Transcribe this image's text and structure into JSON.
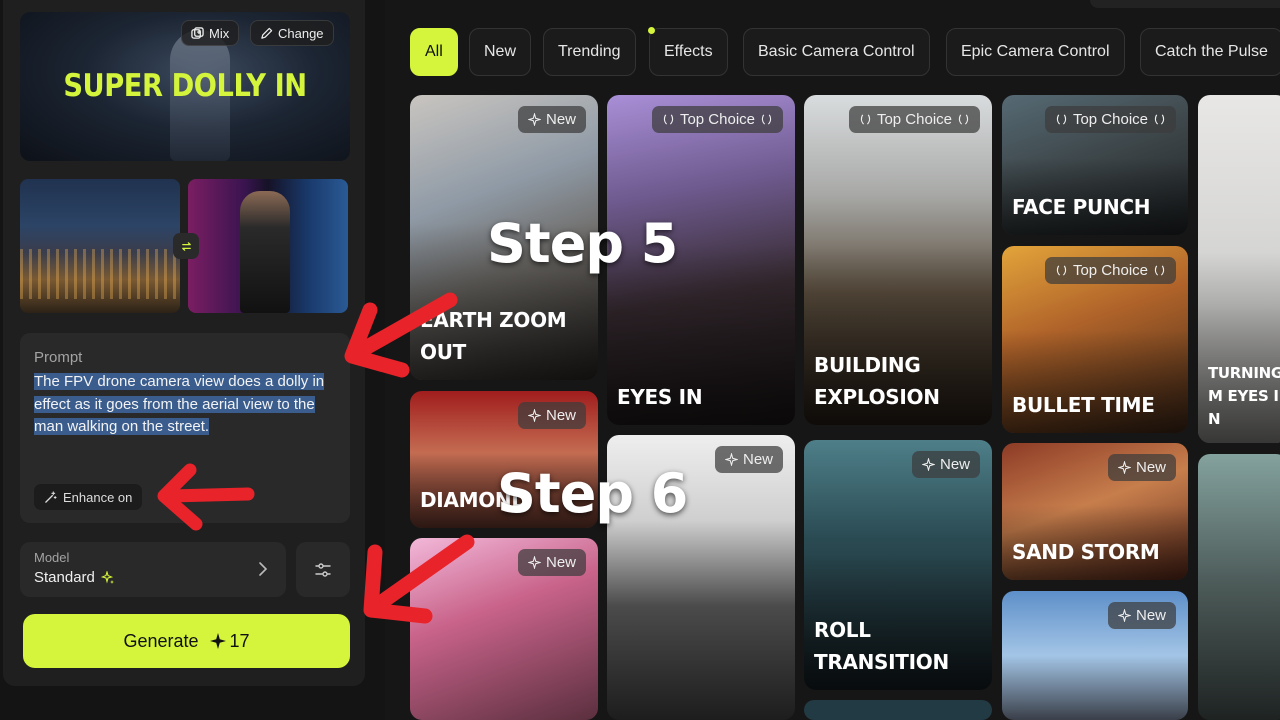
{
  "preset": {
    "title": "SUPER DOLLY IN",
    "mix_label": "Mix",
    "change_label": "Change"
  },
  "prompt": {
    "label": "Prompt",
    "text": "The FPV drone camera view does a dolly in effect as it goes from the aerial view to the man walking on the street.",
    "enhance_label": "Enhance on"
  },
  "model": {
    "label": "Model",
    "value": "Standard"
  },
  "generate": {
    "label": "Generate",
    "cost": "17"
  },
  "tabs": [
    "All",
    "New",
    "Trending",
    "Effects",
    "Basic Camera Control",
    "Epic Camera Control",
    "Catch the Pulse"
  ],
  "cards": {
    "earth_zoom_out": {
      "badge": "New",
      "title": "EARTH ZOOM OUT"
    },
    "diamond": {
      "badge": "New",
      "title": "DIAMOND"
    },
    "big_eyes": {
      "badge": "New"
    },
    "eyes_in": {
      "badge": "Top Choice",
      "title": "EYES IN"
    },
    "portrait_man": {
      "badge": "New"
    },
    "building_explosion": {
      "badge": "Top Choice",
      "title": "BUILDING EXPLOSION"
    },
    "roll_transition": {
      "badge": "New",
      "title": "ROLL TRANSITION"
    },
    "face_punch": {
      "badge": "Top Choice",
      "title": "FACE PUNCH"
    },
    "bullet_time": {
      "badge": "Top Choice",
      "title": "BULLET TIME"
    },
    "sand_storm": {
      "badge": "New",
      "title": "SAND STORM"
    },
    "plane": {
      "badge": "New"
    },
    "turning": {
      "title": "TURNING M EYES IN"
    }
  },
  "annotations": {
    "step5": "Step 5",
    "step6": "Step 6",
    "arrow_color": "#e8232a"
  },
  "colors": {
    "accent": "#d4f53c",
    "panel": "#1f1f1f",
    "selection": "#3a5d8e"
  }
}
